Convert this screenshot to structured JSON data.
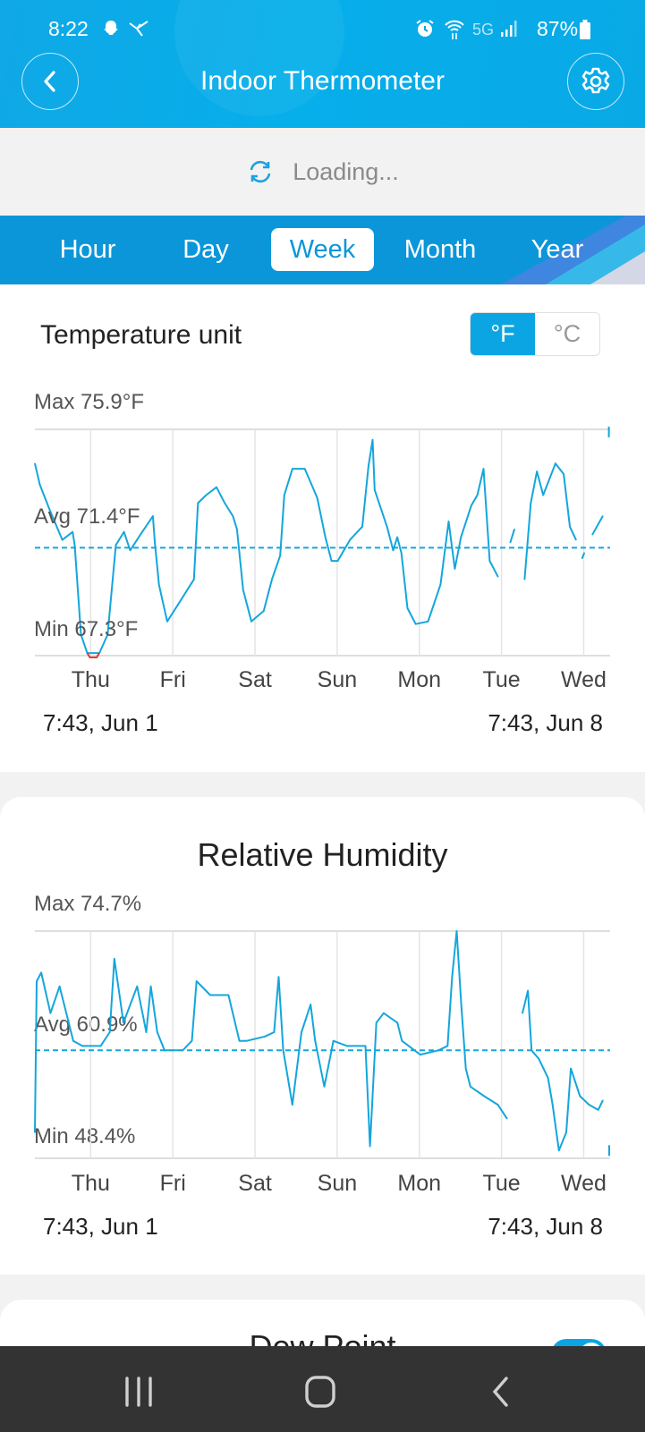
{
  "status_bar": {
    "time": "8:22",
    "network": "5G",
    "battery": "87%",
    "icons": [
      "snapchat-icon",
      "messenger-icon",
      "alarm-icon",
      "wifi-icon",
      "signal-icon",
      "battery-icon"
    ]
  },
  "header": {
    "title": "Indoor Thermometer",
    "back_icon": "chevron-left-icon",
    "settings_icon": "gear-icon"
  },
  "loading": {
    "text": "Loading..."
  },
  "tabs": [
    {
      "label": "Hour",
      "active": false
    },
    {
      "label": "Day",
      "active": false
    },
    {
      "label": "Week",
      "active": true
    },
    {
      "label": "Month",
      "active": false
    },
    {
      "label": "Year",
      "active": false
    }
  ],
  "temperature_card": {
    "unit_label": "Temperature unit",
    "unit_options": [
      "°F",
      "°C"
    ],
    "selected_unit": "°F",
    "max_label": "Max 75.9°F",
    "avg_label": "Avg 71.4°F",
    "min_label": "Min 67.3°F",
    "start_label": "7:43,  Jun 1",
    "end_label": "7:43,  Jun 8"
  },
  "humidity_card": {
    "title": "Relative Humidity",
    "max_label": "Max 74.7%",
    "avg_label": "Avg 60.9%",
    "min_label": "Min 48.4%",
    "start_label": "7:43,  Jun 1",
    "end_label": "7:43,  Jun 8"
  },
  "dew_point_card": {
    "title": "Dew Point",
    "toggle_on": true
  },
  "colors": {
    "accent": "#0ba5e3",
    "line": "#14a6dc",
    "min_highlight": "#e53935",
    "nav_bar": "#333333"
  },
  "chart_data": [
    {
      "type": "line",
      "xlim": [
        "06-01 07:43",
        "06-08 07:43"
      ],
      "ylim": [
        67.3,
        75.9
      ],
      "x_tick_labels": [
        "Thu",
        "Fri",
        "Sat",
        "Sun",
        "Mon",
        "Tue",
        "Wed"
      ],
      "avg": 71.4,
      "max": 75.9,
      "min": 67.3,
      "grid": true,
      "points": [
        [
          "06-01 07:43",
          74.6
        ],
        [
          "06-01 09:09",
          73.8
        ],
        [
          "06-01 12:10",
          72.8
        ],
        [
          "06-01 15:45",
          71.7
        ],
        [
          "06-01 18:45",
          72.0
        ],
        [
          "06-01 19:20",
          71.5
        ],
        [
          "06-01 21:10",
          68.1
        ],
        [
          "06-01 23:00",
          67.4
        ],
        [
          "06-02 02:33",
          67.4
        ],
        [
          "06-02 04:57",
          68.1
        ],
        [
          "06-02 07:21",
          71.5
        ],
        [
          "06-02 09:45",
          72.0
        ],
        [
          "06-02 11:33",
          71.3
        ],
        [
          "06-02 14:33",
          71.9
        ],
        [
          "06-02 18:10",
          72.6
        ],
        [
          "06-02 18:45",
          71.6
        ],
        [
          "06-02 19:57",
          70.0
        ],
        [
          "06-02 22:21",
          68.6
        ],
        [
          "06-03 01:21",
          69.2
        ],
        [
          "06-03 06:10",
          70.2
        ],
        [
          "06-03 07:21",
          73.1
        ],
        [
          "06-03 09:45",
          73.4
        ],
        [
          "06-03 12:45",
          73.7
        ],
        [
          "06-03 15:10",
          73.1
        ],
        [
          "06-03 17:33",
          72.6
        ],
        [
          "06-03 18:45",
          72.1
        ],
        [
          "06-03 20:33",
          69.8
        ],
        [
          "06-03 22:57",
          68.6
        ],
        [
          "06-04 02:33",
          69.0
        ],
        [
          "06-04 04:57",
          70.2
        ],
        [
          "06-04 07:21",
          71.1
        ],
        [
          "06-04 08:33",
          73.4
        ],
        [
          "06-04 10:57",
          74.4
        ],
        [
          "06-04 14:33",
          74.4
        ],
        [
          "06-04 18:10",
          73.3
        ],
        [
          "06-04 20:33",
          71.8
        ],
        [
          "06-04 22:21",
          70.9
        ],
        [
          "06-05 00:10",
          70.9
        ],
        [
          "06-05 03:45",
          71.7
        ],
        [
          "06-05 07:21",
          72.2
        ],
        [
          "06-05 09:09",
          74.5
        ],
        [
          "06-05 10:21",
          75.5
        ],
        [
          "06-05 10:57",
          73.6
        ],
        [
          "06-05 14:33",
          72.2
        ],
        [
          "06-05 16:21",
          71.3
        ],
        [
          "06-05 17:33",
          71.8
        ],
        [
          "06-05 18:45",
          71.2
        ],
        [
          "06-05 20:33",
          69.1
        ],
        [
          "06-05 22:57",
          68.5
        ],
        [
          "06-06 02:33",
          68.6
        ],
        [
          "06-06 06:10",
          70.0
        ],
        [
          "06-06 08:33",
          72.4
        ],
        [
          "06-06 10:21",
          70.6
        ],
        [
          "06-06 12:10",
          71.8
        ],
        [
          "06-06 15:10",
          73.0
        ],
        [
          "06-06 16:57",
          73.4
        ],
        [
          "06-06 18:45",
          74.4
        ],
        [
          "06-06 20:33",
          70.9
        ],
        [
          "06-06 22:57",
          70.3
        ],
        [
          "06-07 00:45",
          null
        ],
        [
          "06-07 02:33",
          71.6
        ],
        [
          "06-07 03:45",
          72.1
        ],
        [
          "06-07 05:10",
          null
        ],
        [
          "06-07 06:45",
          70.2
        ],
        [
          "06-07 08:33",
          73.1
        ],
        [
          "06-07 10:21",
          74.3
        ],
        [
          "06-07 12:10",
          73.4
        ],
        [
          "06-07 15:45",
          74.6
        ],
        [
          "06-07 18:10",
          74.2
        ],
        [
          "06-07 19:57",
          72.2
        ],
        [
          "06-07 21:45",
          71.7
        ],
        [
          "06-07 22:40",
          null
        ],
        [
          "06-07 23:33",
          71.0
        ],
        [
          "06-08 00:10",
          71.2
        ],
        [
          "06-08 01:20",
          null
        ],
        [
          "06-08 02:33",
          71.9
        ],
        [
          "06-08 05:33",
          72.6
        ],
        [
          "06-08 06:30",
          null
        ],
        [
          "06-08 07:21",
          75.8
        ]
      ]
    },
    {
      "type": "line",
      "xlim": [
        "06-01 07:43",
        "06-08 07:43"
      ],
      "ylim": [
        48.4,
        74.7
      ],
      "x_tick_labels": [
        "Thu",
        "Fri",
        "Sat",
        "Sun",
        "Mon",
        "Tue",
        "Wed"
      ],
      "avg": 60.9,
      "max": 74.7,
      "min": 48.4,
      "grid": true,
      "points": [
        [
          "06-01 07:43",
          51.4
        ],
        [
          "06-01 08:15",
          68.9
        ],
        [
          "06-01 09:35",
          69.9
        ],
        [
          "06-01 12:15",
          65.2
        ],
        [
          "06-01 14:55",
          68.3
        ],
        [
          "06-01 17:35",
          64.1
        ],
        [
          "06-01 18:55",
          62.0
        ],
        [
          "06-01 21:35",
          61.4
        ],
        [
          "06-02 02:55",
          61.4
        ],
        [
          "06-02 05:35",
          63.0
        ],
        [
          "06-02 06:55",
          71.5
        ],
        [
          "06-02 09:35",
          64.1
        ],
        [
          "06-02 13:35",
          68.3
        ],
        [
          "06-02 16:15",
          63.0
        ],
        [
          "06-02 17:35",
          68.3
        ],
        [
          "06-02 19:27",
          63.0
        ],
        [
          "06-02 21:35",
          60.9
        ],
        [
          "06-03 02:55",
          60.9
        ],
        [
          "06-03 05:35",
          62.0
        ],
        [
          "06-03 06:55",
          68.9
        ],
        [
          "06-03 10:55",
          67.3
        ],
        [
          "06-03 16:15",
          67.3
        ],
        [
          "06-03 19:27",
          62.0
        ],
        [
          "06-03 21:35",
          62.0
        ],
        [
          "06-04 02:55",
          62.5
        ],
        [
          "06-04 05:35",
          63.0
        ],
        [
          "06-04 06:55",
          69.4
        ],
        [
          "06-04 08:15",
          60.9
        ],
        [
          "06-04 10:55",
          54.6
        ],
        [
          "06-04 13:35",
          63.0
        ],
        [
          "06-04 16:15",
          66.2
        ],
        [
          "06-04 17:35",
          62.0
        ],
        [
          "06-04 20:15",
          56.7
        ],
        [
          "06-04 22:55",
          62.0
        ],
        [
          "06-05 02:55",
          61.4
        ],
        [
          "06-05 08:15",
          61.4
        ],
        [
          "06-05 09:35",
          49.8
        ],
        [
          "06-05 11:27",
          64.1
        ],
        [
          "06-05 13:35",
          65.2
        ],
        [
          "06-05 17:35",
          64.1
        ],
        [
          "06-05 18:55",
          62.0
        ],
        [
          "06-06 00:15",
          60.4
        ],
        [
          "06-06 05:35",
          60.9
        ],
        [
          "06-06 08:15",
          61.4
        ],
        [
          "06-06 09:35",
          69.4
        ],
        [
          "06-06 10:55",
          74.7
        ],
        [
          "06-06 12:15",
          66.2
        ],
        [
          "06-06 13:35",
          58.8
        ],
        [
          "06-06 14:55",
          56.7
        ],
        [
          "06-06 18:55",
          55.6
        ],
        [
          "06-06 22:55",
          54.6
        ],
        [
          "06-07 01:35",
          53.0
        ],
        [
          "06-07 02:55",
          null
        ],
        [
          "06-07 06:07",
          65.2
        ],
        [
          "06-07 07:43",
          67.8
        ],
        [
          "06-07 08:47",
          60.9
        ],
        [
          "06-07 10:55",
          59.9
        ],
        [
          "06-07 13:35",
          57.7
        ],
        [
          "06-07 14:55",
          54.6
        ],
        [
          "06-07 16:47",
          49.3
        ],
        [
          "06-07 18:55",
          51.4
        ],
        [
          "06-07 20:15",
          58.8
        ],
        [
          "06-07 22:55",
          55.6
        ],
        [
          "06-08 01:35",
          54.6
        ],
        [
          "06-08 04:15",
          54.0
        ],
        [
          "06-08 05:35",
          55.1
        ],
        [
          "06-08 06:23",
          null
        ],
        [
          "06-08 07:27",
          49.3
        ]
      ]
    }
  ]
}
